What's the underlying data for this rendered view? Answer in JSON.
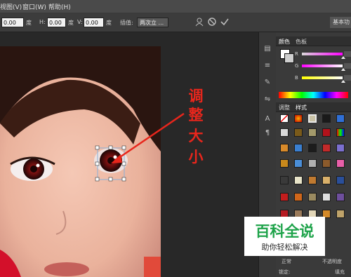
{
  "menu": {
    "view": "视图(V)",
    "window": "窗口(W)",
    "help": "帮助(H)"
  },
  "options": {
    "field_left_value": "0.00",
    "field_left_unit": "度",
    "h_label": "H:",
    "h_value": "0.00",
    "h_unit": "度",
    "v_label": "V:",
    "v_value": "0.00",
    "v_unit": "度",
    "interp_label": "插值:",
    "interp_value": "两次立 ...",
    "cancel_label": "基本功"
  },
  "icons": {
    "warp": "warp-mode-icon",
    "cancel": "cancel-transform-icon",
    "commit": "commit-transform-icon"
  },
  "panel": {
    "tab_color": "颜色",
    "tab_swatches": "色板",
    "tab_adjust": "调整",
    "tab_styles": "样式",
    "r_label": "R",
    "g_label": "G",
    "b_label": "B"
  },
  "layers": {
    "mode": "正常",
    "opacity_label": "不透明度",
    "lock_label": "锁定:",
    "fill_label": "填充"
  },
  "annotation": {
    "line1": "调",
    "line2": "整",
    "line3": "大",
    "line4": "小"
  },
  "watermark": {
    "main": "百科全说",
    "sub": "助你轻松解决"
  },
  "colors": {
    "menubar": "#4a4a4a",
    "optionsbar": "#3c3c3c",
    "workspace": "#282828",
    "panel": "#3a3a3a",
    "annotation_red": "#e8261c",
    "watermark_green": "#1ea34a"
  }
}
